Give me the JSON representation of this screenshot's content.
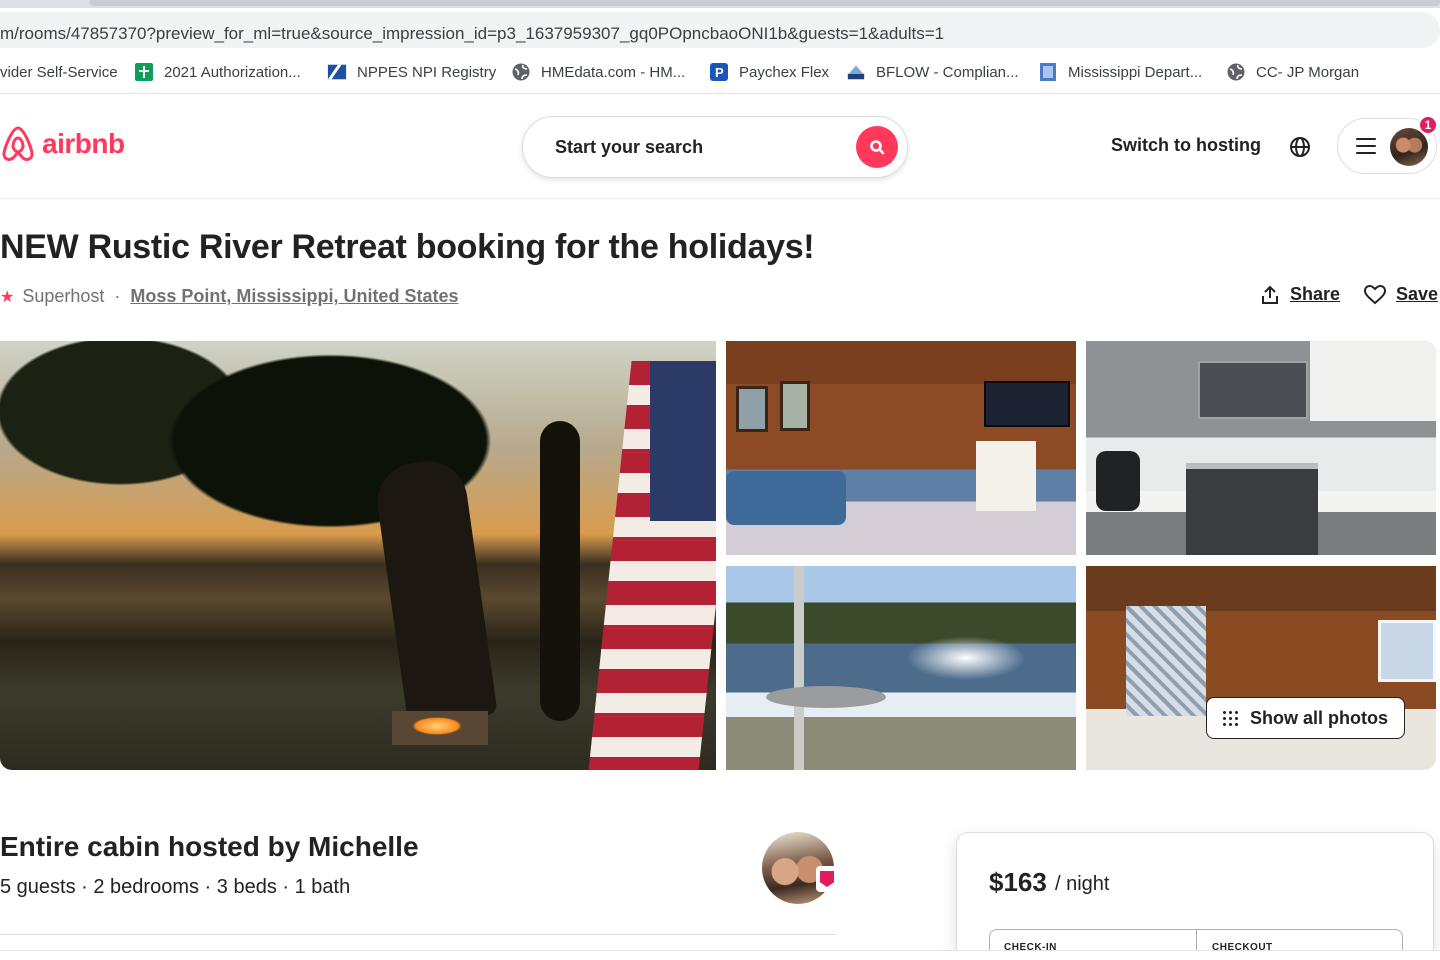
{
  "browser": {
    "url_main": "m/rooms/47857370?preview_for_ml=true&source_impression_id=p3_1637959307_gq0POpncbaoONI1b&guests=1&adults=1",
    "bookmarks": [
      {
        "label": "vider Self-Service",
        "icon": "none"
      },
      {
        "label": "2021 Authorization...",
        "icon": "sheets-icon"
      },
      {
        "label": "NPPES NPI Registry",
        "icon": "nppes-icon"
      },
      {
        "label": "HMEdata.com - HM...",
        "icon": "globe-icon"
      },
      {
        "label": "Paychex Flex",
        "icon": "paychex-icon"
      },
      {
        "label": "BFLOW - Complian...",
        "icon": "bflow-icon"
      },
      {
        "label": "Mississippi Depart...",
        "icon": "doc-icon"
      },
      {
        "label": "CC- JP Morgan",
        "icon": "globe-icon"
      }
    ]
  },
  "header": {
    "logo_text": "airbnb",
    "search_placeholder": "Start your search",
    "switch_hosting": "Switch to hosting",
    "notification_count": "1",
    "brand_color": "#ff385c"
  },
  "listing": {
    "title": "NEW Rustic River Retreat booking for the holidays!",
    "superhost": "Superhost",
    "separator": "·",
    "location": "Moss Point, Mississippi, United States",
    "share": "Share",
    "save": "Save",
    "show_all_photos": "Show all photos"
  },
  "host": {
    "title": "Entire cabin hosted by Michelle",
    "details": "5 guests · 2 bedrooms · 3 beds · 1 bath"
  },
  "booking": {
    "price": "$163",
    "per_night": "/ night",
    "check_in_label": "CHECK-IN",
    "checkout_label": "CHECKOUT"
  }
}
